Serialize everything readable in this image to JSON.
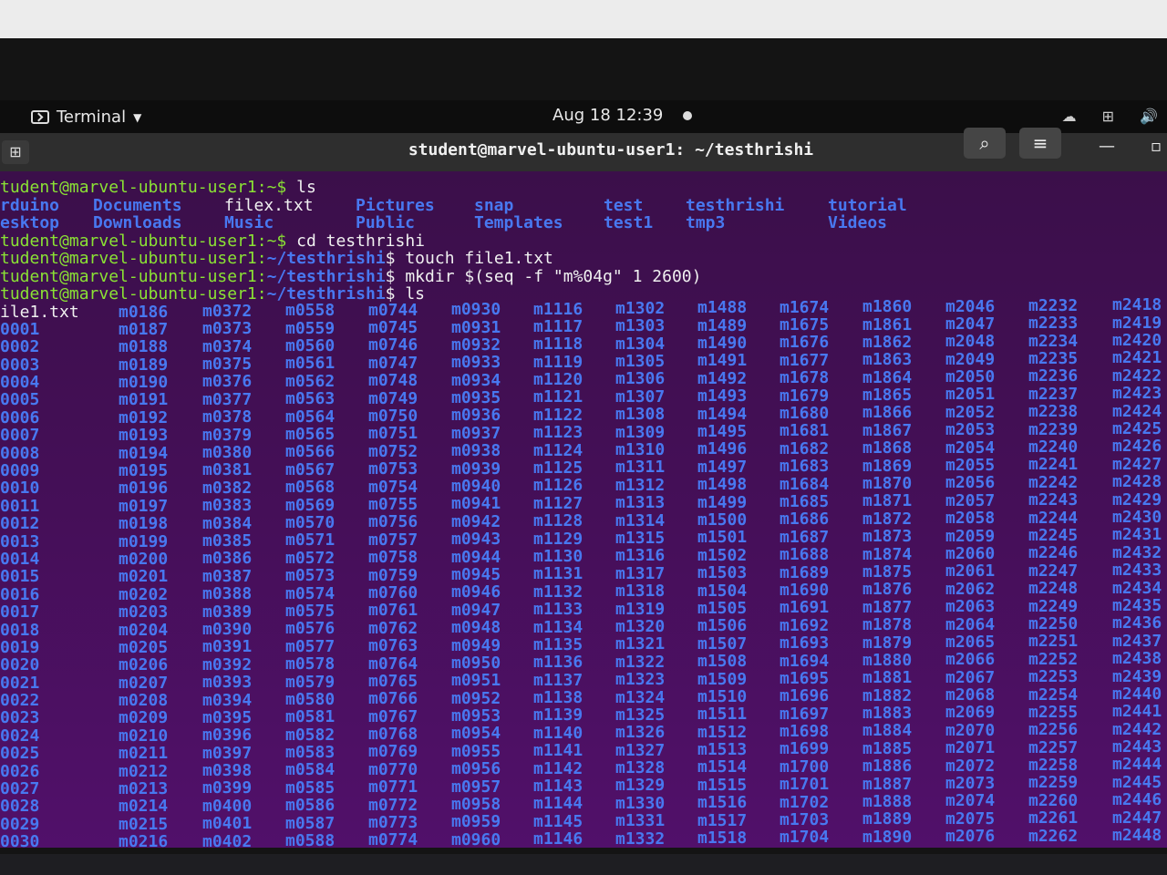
{
  "topbar": {
    "app_label": "Terminal",
    "datetime": "Aug 18  12:39"
  },
  "window": {
    "title": "student@marvel-ubuntu-user1: ~/testhrishi"
  },
  "terminal": {
    "prompt_home": "tudent@marvel-ubuntu-user1:~$ ",
    "prompt_dir_user": "tudent@marvel-ubuntu-user1:",
    "prompt_dir_path": "~/testhrishi",
    "prompt_dir_end": "$ ",
    "cmd1": "ls",
    "ls_home_row1": [
      {
        "text": "rduino",
        "type": "dir"
      },
      {
        "text": "Documents",
        "type": "dir"
      },
      {
        "text": "filex.txt",
        "type": "file"
      },
      {
        "text": "Pictures",
        "type": "dir"
      },
      {
        "text": "snap",
        "type": "dir"
      },
      {
        "text": "test",
        "type": "dir"
      },
      {
        "text": "testhrishi",
        "type": "dir"
      },
      {
        "text": "tutorial",
        "type": "dir"
      }
    ],
    "ls_home_row2": [
      {
        "text": "esktop",
        "type": "dir"
      },
      {
        "text": "Downloads",
        "type": "dir"
      },
      {
        "text": "Music",
        "type": "dir"
      },
      {
        "text": "Public",
        "type": "dir"
      },
      {
        "text": "Templates",
        "type": "dir"
      },
      {
        "text": "test1",
        "type": "dir"
      },
      {
        "text": "tmp3",
        "type": "dir"
      },
      {
        "text": "Videos",
        "type": "dir"
      }
    ],
    "cmd2": "cd testhrishi",
    "cmd3": "touch file1.txt",
    "cmd4": "mkdir $(seq -f \"m%04g\" 1 2600)",
    "cmd5": "ls",
    "first_col": [
      "ile1.txt",
      "0001",
      "0002",
      "0003",
      "0004",
      "0005",
      "0006",
      "0007",
      "0008",
      "0009",
      "0010",
      "0011",
      "0012",
      "0013",
      "0014",
      "0015",
      "0016",
      "0017",
      "0018",
      "0019",
      "0020",
      "0021",
      "0022",
      "0023",
      "0024",
      "0025",
      "0026",
      "0027",
      "0028",
      "0029",
      "0030"
    ],
    "column_starts": [
      186,
      372,
      558,
      744,
      930,
      1116,
      1302,
      1488,
      1674,
      1860,
      2046,
      2232,
      2418
    ],
    "visible_rows": 31,
    "colors": {
      "dir": "#4878f0",
      "file": "#f0f0f0",
      "prompt": "#8ae234",
      "background": "#450f58"
    }
  }
}
